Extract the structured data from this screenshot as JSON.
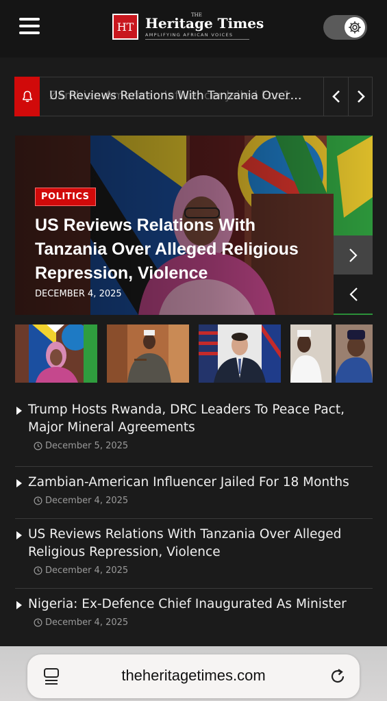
{
  "header": {
    "logo_initials": "HT",
    "logo_the": "THE",
    "logo_title": "Heritage Times",
    "logo_tagline": "AMPLIFYING AFRICAN VOICES",
    "theme_toggle": "gear-icon"
  },
  "breaking": {
    "ticker_text": "US Reviews Relations With Tanzania Over…",
    "ticker_ghost_text": "Zambian-American Influencer Jailed For 1…"
  },
  "hero": {
    "category": "POLITICS",
    "title": "US Reviews Relations With Tanzania Over Alleged Religious Repression, Violence",
    "date": "DECEMBER 4, 2025"
  },
  "news": [
    {
      "title": "Trump Hosts Rwanda, DRC Leaders To Peace Pact, Major Mineral Agreements",
      "date": "December 5, 2025"
    },
    {
      "title": "Zambian-American Influencer Jailed For 18 Months",
      "date": "December 4, 2025"
    },
    {
      "title": "US Reviews Relations With Tanzania Over Alleged Religious Repression, Violence",
      "date": "December 4, 2025"
    },
    {
      "title": "Nigeria: Ex-Defence Chief Inaugurated As Minister",
      "date": "December 4, 2025"
    }
  ],
  "browser": {
    "url": "theheritagetimes.com"
  },
  "colors": {
    "accent_red": "#d10a0a",
    "background": "#1b1b1b",
    "header_bg": "#151515"
  }
}
